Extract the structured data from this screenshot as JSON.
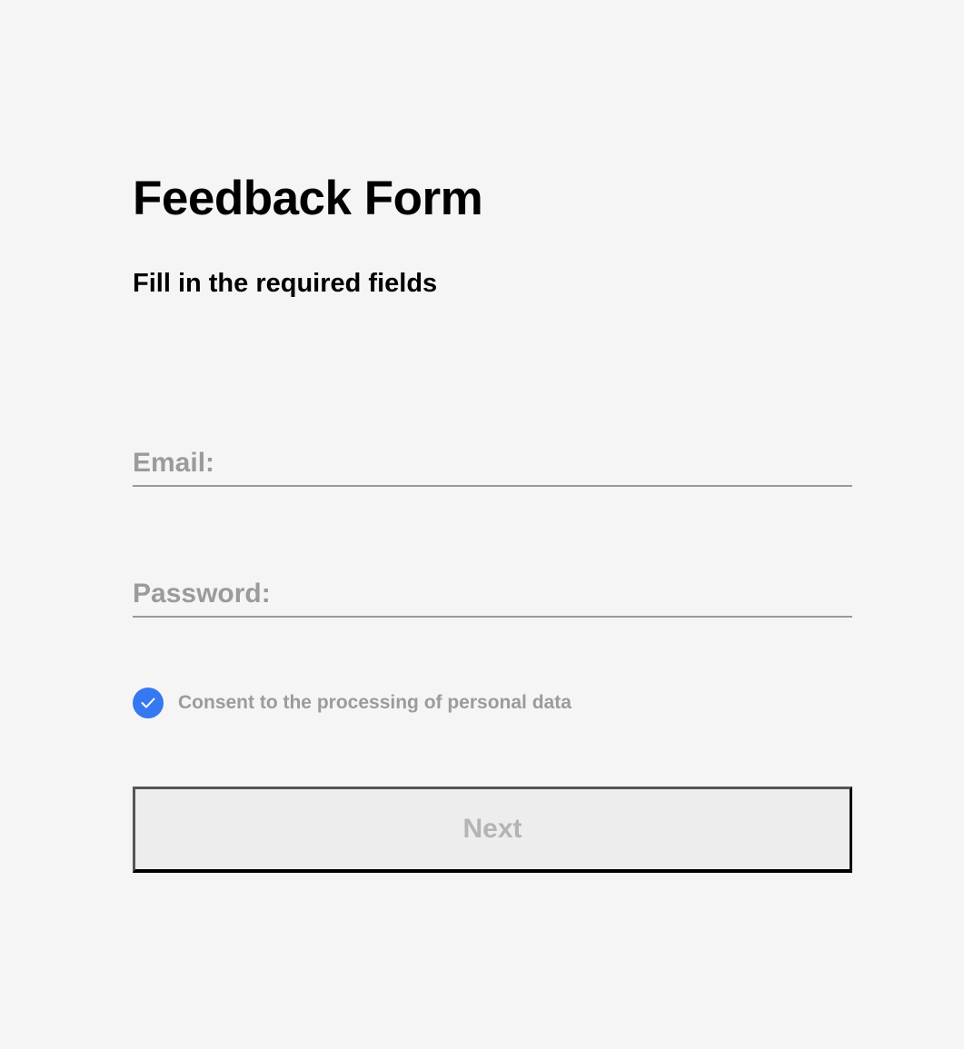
{
  "form": {
    "title": "Feedback Form",
    "subtitle": "Fill in the required fields",
    "email": {
      "placeholder": "Email:",
      "value": ""
    },
    "password": {
      "placeholder": "Password:",
      "value": ""
    },
    "consent": {
      "label": "Consent to the processing of personal data",
      "checked": true
    },
    "next_label": "Next"
  },
  "colors": {
    "background": "#f5f5f5",
    "checkbox_accent": "#3578f0",
    "placeholder_text": "#9b9b9b",
    "button_fill": "#ededed",
    "button_text": "#b4b4b4"
  },
  "icons": {
    "checkbox": "checkmark-icon"
  }
}
